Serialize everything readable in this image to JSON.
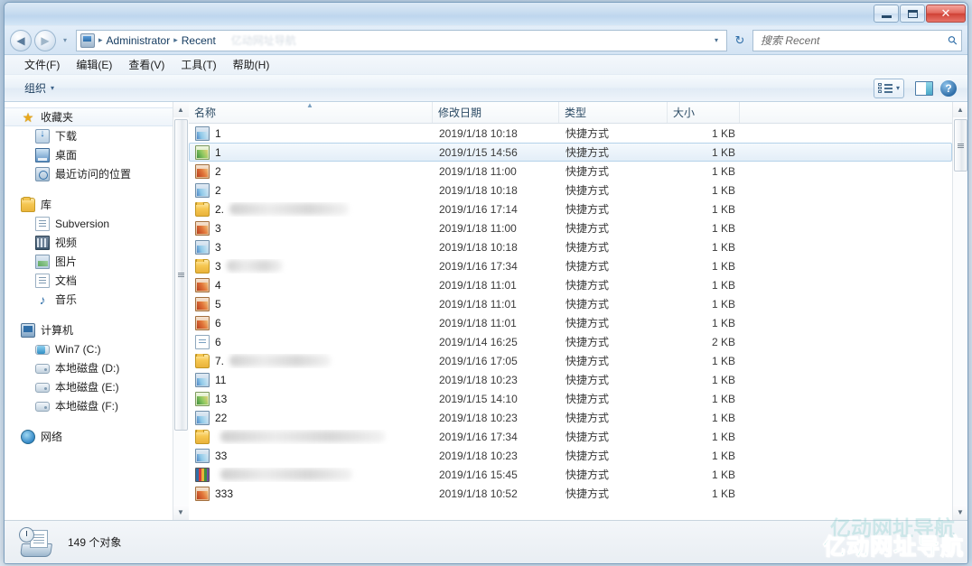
{
  "window": {
    "controls": {
      "minimize": "最小化",
      "maximize": "最大化",
      "close": "✕"
    }
  },
  "address": {
    "back_label": "◀",
    "forward_label": "▶",
    "history_label": "▾",
    "crumb_icon": "recent-items-icon",
    "crumbs": [
      "Administrator",
      "Recent"
    ],
    "separator": "▸",
    "dropdown_label": "▾",
    "refresh_label": "↻"
  },
  "search": {
    "placeholder": "搜索 Recent",
    "value": "",
    "icon": "search-icon"
  },
  "menubar": {
    "items": [
      "文件(F)",
      "编辑(E)",
      "查看(V)",
      "工具(T)",
      "帮助(H)"
    ]
  },
  "commandbar": {
    "organize_label": "组织",
    "organize_caret": "▾",
    "views_caret": "▾",
    "help_label": "?"
  },
  "sidebar": {
    "groups": [
      {
        "label": "收藏夹",
        "icon": "star-icon",
        "selected": true,
        "items": [
          {
            "label": "下载",
            "icon": "download-icon"
          },
          {
            "label": "桌面",
            "icon": "desktop-icon"
          },
          {
            "label": "最近访问的位置",
            "icon": "recent-places-icon"
          }
        ]
      },
      {
        "label": "库",
        "icon": "library-folder-icon",
        "selected": false,
        "items": [
          {
            "label": "Subversion",
            "icon": "document-icon"
          },
          {
            "label": "视频",
            "icon": "video-icon"
          },
          {
            "label": "图片",
            "icon": "picture-icon"
          },
          {
            "label": "文档",
            "icon": "document-icon"
          },
          {
            "label": "音乐",
            "icon": "music-icon"
          }
        ]
      },
      {
        "label": "计算机",
        "icon": "computer-icon",
        "selected": false,
        "items": [
          {
            "label": "Win7 (C:)",
            "icon": "system-drive-icon"
          },
          {
            "label": "本地磁盘 (D:)",
            "icon": "drive-icon"
          },
          {
            "label": "本地磁盘 (E:)",
            "icon": "drive-icon"
          },
          {
            "label": "本地磁盘 (F:)",
            "icon": "drive-icon"
          }
        ]
      },
      {
        "label": "网络",
        "icon": "network-icon",
        "selected": false,
        "items": []
      }
    ]
  },
  "filelist": {
    "columns": [
      {
        "key": "name",
        "label": "名称"
      },
      {
        "key": "date",
        "label": "修改日期"
      },
      {
        "key": "type",
        "label": "类型"
      },
      {
        "key": "size",
        "label": "大小"
      }
    ],
    "sort_indicator": "▲",
    "rows": [
      {
        "name": "1",
        "redacted": 0,
        "icon": "photo-blue-icon",
        "date": "2019/1/18 10:18",
        "type": "快捷方式",
        "size": "1 KB",
        "selected": false
      },
      {
        "name": "1",
        "redacted": 0,
        "icon": "photo-green-icon",
        "date": "2019/1/15 14:56",
        "type": "快捷方式",
        "size": "1 KB",
        "selected": true
      },
      {
        "name": "2",
        "redacted": 0,
        "icon": "photo-orange-icon",
        "date": "2019/1/18 11:00",
        "type": "快捷方式",
        "size": "1 KB",
        "selected": false
      },
      {
        "name": "2",
        "redacted": 0,
        "icon": "photo-blue-icon",
        "date": "2019/1/18 10:18",
        "type": "快捷方式",
        "size": "1 KB",
        "selected": false
      },
      {
        "name": "2.",
        "redacted": 132,
        "icon": "folder-icon",
        "date": "2019/1/16 17:14",
        "type": "快捷方式",
        "size": "1 KB",
        "selected": false
      },
      {
        "name": "3",
        "redacted": 0,
        "icon": "photo-orange-icon",
        "date": "2019/1/18 11:00",
        "type": "快捷方式",
        "size": "1 KB",
        "selected": false
      },
      {
        "name": "3",
        "redacted": 0,
        "icon": "photo-blue-icon",
        "date": "2019/1/18 10:18",
        "type": "快捷方式",
        "size": "1 KB",
        "selected": false
      },
      {
        "name": "3",
        "redacted": 62,
        "icon": "folder-icon",
        "date": "2019/1/16 17:34",
        "type": "快捷方式",
        "size": "1 KB",
        "selected": false
      },
      {
        "name": "4",
        "redacted": 0,
        "icon": "photo-orange-icon",
        "date": "2019/1/18 11:01",
        "type": "快捷方式",
        "size": "1 KB",
        "selected": false
      },
      {
        "name": "5",
        "redacted": 0,
        "icon": "photo-orange-icon",
        "date": "2019/1/18 11:01",
        "type": "快捷方式",
        "size": "1 KB",
        "selected": false
      },
      {
        "name": "6",
        "redacted": 0,
        "icon": "photo-orange-icon",
        "date": "2019/1/18 11:01",
        "type": "快捷方式",
        "size": "1 KB",
        "selected": false
      },
      {
        "name": "6",
        "redacted": 0,
        "icon": "document-icon",
        "date": "2019/1/14 16:25",
        "type": "快捷方式",
        "size": "2 KB",
        "selected": false
      },
      {
        "name": "7.",
        "redacted": 112,
        "icon": "folder-icon",
        "date": "2019/1/16 17:05",
        "type": "快捷方式",
        "size": "1 KB",
        "selected": false
      },
      {
        "name": "11",
        "redacted": 0,
        "icon": "photo-blue-icon",
        "date": "2019/1/18 10:23",
        "type": "快捷方式",
        "size": "1 KB",
        "selected": false
      },
      {
        "name": "13",
        "redacted": 0,
        "icon": "photo-green-icon",
        "date": "2019/1/15 14:10",
        "type": "快捷方式",
        "size": "1 KB",
        "selected": false
      },
      {
        "name": "22",
        "redacted": 0,
        "icon": "photo-blue-icon",
        "date": "2019/1/18 10:23",
        "type": "快捷方式",
        "size": "1 KB",
        "selected": false
      },
      {
        "name": "",
        "redacted": 182,
        "icon": "folder-icon",
        "date": "2019/1/16 17:34",
        "type": "快捷方式",
        "size": "1 KB",
        "selected": false
      },
      {
        "name": "33",
        "redacted": 0,
        "icon": "photo-blue-icon",
        "date": "2019/1/18 10:23",
        "type": "快捷方式",
        "size": "1 KB",
        "selected": false
      },
      {
        "name": "",
        "redacted": 146,
        "icon": "books-icon",
        "date": "2019/1/16 15:45",
        "type": "快捷方式",
        "size": "1 KB",
        "selected": false
      },
      {
        "name": "333",
        "redacted": 0,
        "icon": "photo-orange-icon",
        "date": "2019/1/18 10:52",
        "type": "快捷方式",
        "size": "1 KB",
        "selected": false
      }
    ]
  },
  "statusbar": {
    "count_text": "149 个对象",
    "icon": "recent-items-icon"
  },
  "watermark": {
    "text": "亿动网址导航",
    "ghost_text": "亿动网址导航",
    "color": "#29b3a8"
  }
}
